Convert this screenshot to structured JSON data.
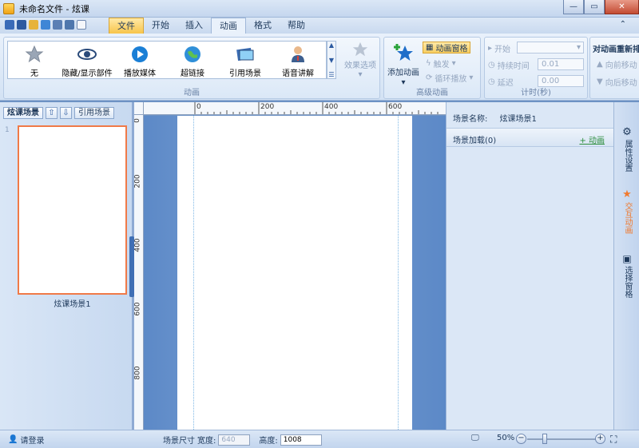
{
  "window": {
    "title": "未命名文件 - 炫课",
    "minimize": "—",
    "restore": "▭",
    "close": "✕"
  },
  "tabs": {
    "file": "文件",
    "items": [
      "开始",
      "插入",
      "动画",
      "格式",
      "帮助"
    ],
    "active": "动画"
  },
  "ribbon": {
    "animation_group": {
      "label": "动画",
      "gallery": [
        {
          "label": "无",
          "icon": "star-icon"
        },
        {
          "label": "隐藏/显示部件",
          "icon": "eye-icon"
        },
        {
          "label": "播放媒体",
          "icon": "play-icon"
        },
        {
          "label": "超链接",
          "icon": "globe-icon"
        },
        {
          "label": "引用场景",
          "icon": "scene-icon"
        },
        {
          "label": "语音讲解",
          "icon": "speaker-icon"
        }
      ],
      "effect_options": "效果选项"
    },
    "advanced_group": {
      "label": "高级动画",
      "add_animation": "添加动画",
      "animation_pane": "动画窗格",
      "trigger": "触发",
      "loop_play": "循环播放"
    },
    "timing_group": {
      "label": "计时(秒)",
      "start_label": "开始",
      "start_value": "",
      "duration_label": "持续时间",
      "duration_value": "0.01",
      "delay_label": "延迟",
      "delay_value": "0.00"
    },
    "reorder_group": {
      "title": "对动画重新排",
      "move_earlier": "向前移动",
      "move_later": "向后移动"
    }
  },
  "scene_panel": {
    "tab_scenes": "炫课场景",
    "tab_reference": "引用场景",
    "thumb_number": "1",
    "scene_label": "炫课场景1"
  },
  "rulers": {
    "top": [
      "0",
      "200",
      "400",
      "600"
    ],
    "left": [
      "0",
      "200",
      "400",
      "600",
      "800"
    ]
  },
  "properties": {
    "scene_name_label": "场景名称:",
    "scene_name_value": "炫课场景1",
    "scene_load_label": "场景加载(0)",
    "add_animation_link": "+ 动画"
  },
  "side_tabs": [
    {
      "label": "属性设置",
      "icon": "gear-icon",
      "active": false
    },
    {
      "label": "交互动画",
      "icon": "star-icon",
      "active": true
    },
    {
      "label": "选择窗格",
      "icon": "window-icon",
      "active": false
    }
  ],
  "statusbar": {
    "login": "请登录",
    "scene_size_label": "场景尺寸",
    "width_label": "宽度:",
    "width_value": "640",
    "height_label": "高度:",
    "height_value": "1008",
    "zoom": "50%",
    "zoom_fraction": 0.25
  },
  "colors": {
    "accent_orange": "#f07a48",
    "ribbon_highlight": "#f8cf63",
    "workspace_blue": "#5c89c7"
  }
}
